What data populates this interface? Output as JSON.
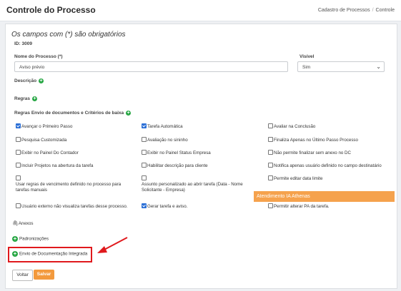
{
  "page": {
    "title": "Controle do Processo",
    "breadcrumb": [
      "Cadastro de Processos",
      "Controle"
    ]
  },
  "form": {
    "required_note": "Os campos com (*) são obrigatórios",
    "id_text": "ID: 3009",
    "nome_label": "Nome do Processo (*)",
    "nome_value": "Aviso prévio",
    "visivel_label": "Visível",
    "visivel_value": "Sim",
    "descricao_label": "Descrição",
    "regras_label": "Regras",
    "regras_envio_label": "Regras Envio de documentos e Critérios de baixa"
  },
  "options": [
    {
      "label": "Avançar o Primeiro Passo",
      "checked": true
    },
    {
      "label": "Tarefa Automática",
      "checked": true
    },
    {
      "label": "Avaliar na Conclusão",
      "checked": false
    },
    {
      "label": "Pesquisa Customizada",
      "checked": false
    },
    {
      "label": "Avaliação no sininho",
      "checked": false
    },
    {
      "label": "Finaliza Apenas no Último Passo Processo",
      "checked": false
    },
    {
      "label": "Exibir no Painel Do Contador",
      "checked": false
    },
    {
      "label": "Exibir no Painel Status Empresa",
      "checked": false
    },
    {
      "label": "Não permite finalizar sem anexo no DC",
      "checked": false
    },
    {
      "label": "Incluir Projetos na abertura da tarefa",
      "checked": false
    },
    {
      "label": "Habilitar descrição para cliente",
      "checked": false
    },
    {
      "label": "Notifica apenas usuário definido no campo destinatário",
      "checked": false
    },
    {
      "label": "Usar regras de vencimento definido no processo para tarefas manuais",
      "checked": false
    },
    {
      "label": "Assunto personalizado ao abrir tarefa (Data - Nome Solicitante - Empresa)",
      "checked": false
    },
    {
      "label": "Permite editar data limite",
      "checked": false
    },
    {
      "label": "Usuário externo não visualiza tarefas desse processo.",
      "checked": false
    },
    {
      "label": "Gerar tarefa e aviso.",
      "checked": true
    },
    {
      "label": "Permitir alterar PA da tarefa.",
      "checked": false
    }
  ],
  "tooltip_text": "Atendimento IA Athenas",
  "sections": {
    "anexos": "Anexos",
    "padronizacoes": "Padronizações",
    "envio_doc": "Envio de Documentação Integrada"
  },
  "buttons": {
    "voltar": "Voltar",
    "salvar": "Salvar"
  },
  "colors": {
    "accent": "#f39a3d",
    "highlight_box": "#e0191d",
    "add_icon": "#28a745",
    "checkbox_checked": "#2b6fd6"
  }
}
